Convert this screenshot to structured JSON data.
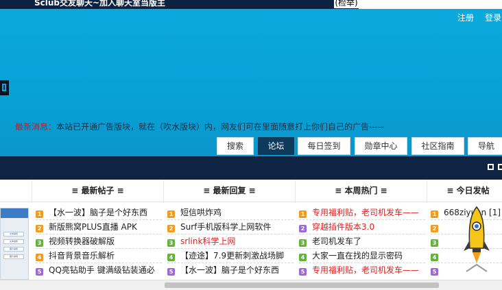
{
  "topbar": {
    "title": "Sclub交友聊天~加入聊天室当版主",
    "report_label": "(检举)"
  },
  "auth": {
    "register": "注册",
    "login": "登录"
  },
  "notice": {
    "label": "最新消息：",
    "text": "本站已开通广告版块，就在（吹水版块）内，网友们可在里面随意打上你们自己的广告-----"
  },
  "nav_tabs": [
    "搜索",
    "论坛",
    "每日签到",
    "勋章中心",
    "社区指南",
    "导航"
  ],
  "nav_active": "论坛",
  "columns": {
    "new_posts": {
      "title": "≡ 最新帖子 ≡",
      "items": [
        {
          "icon": "orange-square-icon",
          "text": "【水一波】脑子是个好东西"
        },
        {
          "icon": "orange-square-icon",
          "text": "新版熊窝PLUS直播 APK"
        },
        {
          "icon": "green-square-icon",
          "text": "视频转换器破解版"
        },
        {
          "icon": "orange-square-icon",
          "text": "抖音背景音乐解析"
        },
        {
          "icon": "purple-square-icon",
          "text": "QQ亮钻助手 键满级钻装通必"
        }
      ]
    },
    "new_replies": {
      "title": "≡ 最新回复 ≡",
      "items": [
        {
          "icon": "orange-square-icon",
          "text": "短信哄炸鸡"
        },
        {
          "icon": "orange-square-icon",
          "text": "Surf手机版科学上网软件"
        },
        {
          "icon": "green-square-icon",
          "text": "srlink科学上网",
          "red": true
        },
        {
          "icon": "green-square-icon",
          "text": "【迹途】7.9更新刺激战场脚"
        },
        {
          "icon": "purple-square-icon",
          "text": "【水一波】脑子是个好东西"
        }
      ]
    },
    "weekly_hot": {
      "title": "≡ 本周热门 ≡",
      "items": [
        {
          "icon": "orange-square-icon",
          "text": "专用福利贴，老司机发车——",
          "red": true
        },
        {
          "icon": "purple-square-icon",
          "text": "穿越插件版本3.0",
          "red": true
        },
        {
          "icon": "green-square-icon",
          "text": "老司机发车了"
        },
        {
          "icon": "green-square-icon",
          "text": "大家一直在找的显示密码"
        },
        {
          "icon": "purple-square-icon",
          "text": "专用福利贴，老司机发车——",
          "red": true
        }
      ]
    },
    "today_posters": {
      "title": "≡ 今日发帖",
      "items": [
        {
          "icon": "orange-square-icon",
          "text": "668ziyuan [1]"
        },
        {
          "icon": "orange-square-icon",
          "text": ""
        },
        {
          "icon": "green-square-icon",
          "text": ""
        },
        {
          "icon": "green-square-icon",
          "text": ""
        },
        {
          "icon": "purple-square-icon",
          "text": ""
        }
      ]
    }
  },
  "thumbnail_buttons": [
    "文本编辑",
    "文本编辑",
    "图片编辑",
    "图片编辑"
  ],
  "colors": {
    "banner": "#08a1d6",
    "navstrip": "#0f2442",
    "active_tab": "#0e3a5c",
    "notice_label": "#d4121a",
    "hot_link": "#e02020"
  }
}
